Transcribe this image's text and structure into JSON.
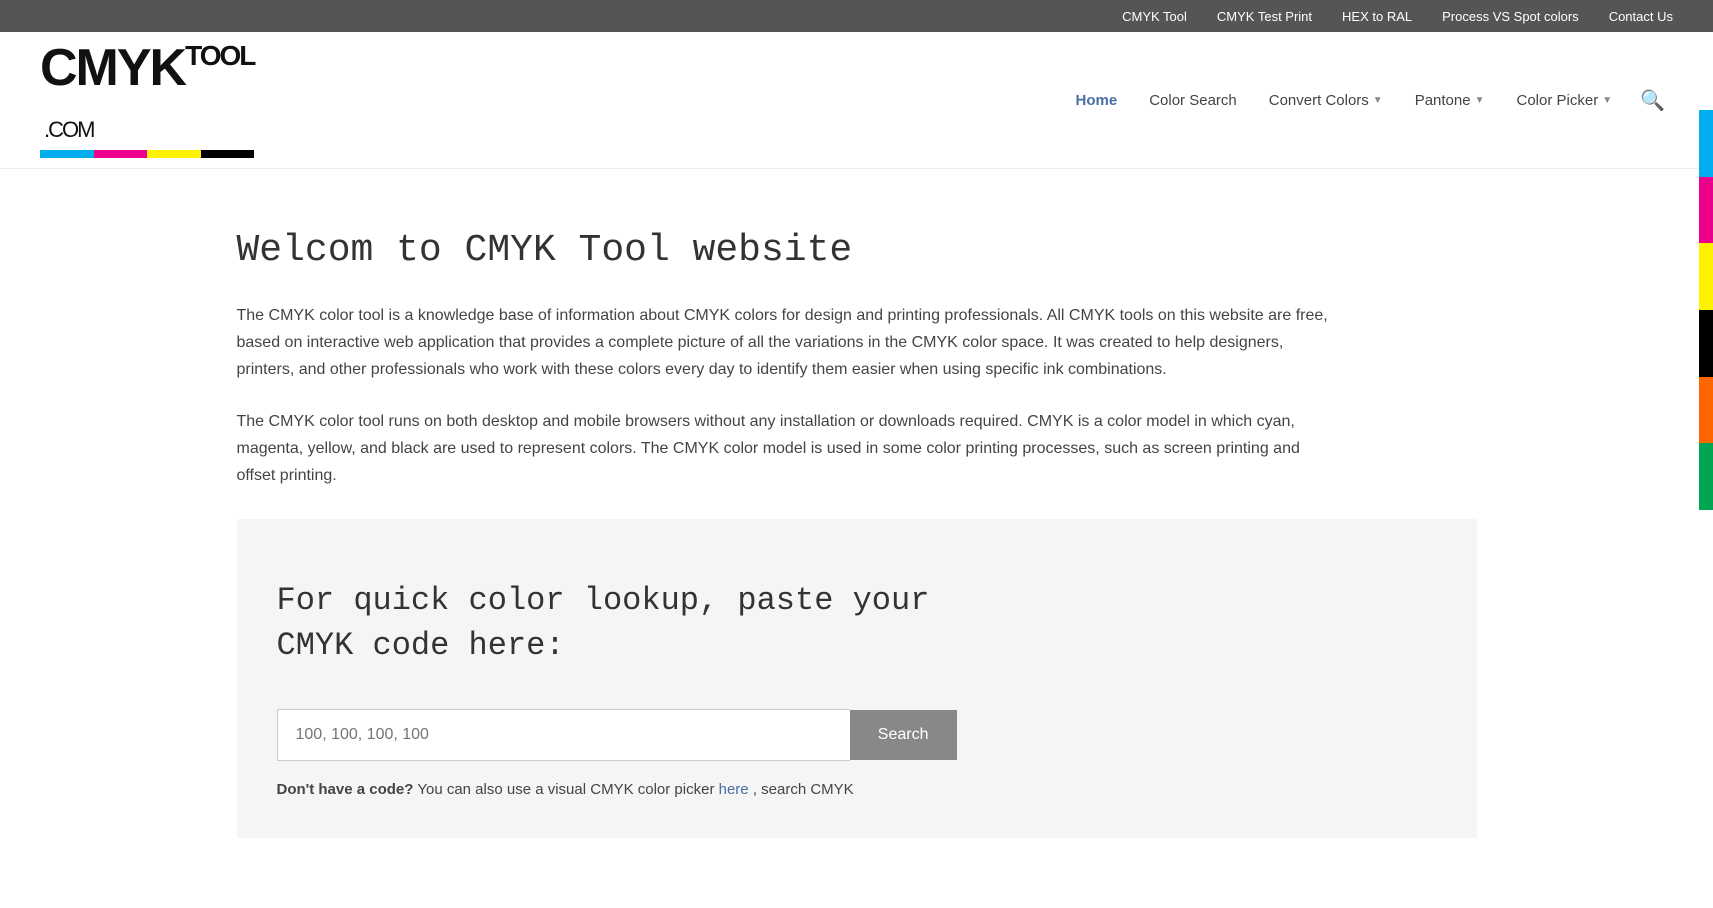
{
  "topbar": {
    "links": [
      {
        "label": "CMYK Tool",
        "id": "cmyk-tool"
      },
      {
        "label": "CMYK Test Print",
        "id": "cmyk-test-print"
      },
      {
        "label": "HEX to RAL",
        "id": "hex-to-ral"
      },
      {
        "label": "Process VS Spot colors",
        "id": "process-vs-spot"
      },
      {
        "label": "Contact Us",
        "id": "contact-us"
      }
    ]
  },
  "logo": {
    "cmyk": "CMYK",
    "tool": "TOOL",
    "dotcom": ".COM"
  },
  "nav": {
    "items": [
      {
        "label": "Home",
        "active": true,
        "hasArrow": false
      },
      {
        "label": "Color Search",
        "active": false,
        "hasArrow": false
      },
      {
        "label": "Convert Colors",
        "active": false,
        "hasArrow": true
      },
      {
        "label": "Pantone",
        "active": false,
        "hasArrow": true
      },
      {
        "label": "Color Picker",
        "active": false,
        "hasArrow": true
      }
    ]
  },
  "main": {
    "page_title": "Welcom to CMYK Tool website",
    "paragraph1": "The CMYK color tool is a knowledge base of information about CMYK colors for design and printing professionals. All CMYK tools on this website are free, based on interactive web application that provides a complete picture of all the variations in the CMYK color space. It was created to help designers, printers, and other professionals who work with these colors every day to identify them easier when using specific ink combinations.",
    "paragraph2": "The CMYK color tool runs on both desktop and mobile browsers without any installation or downloads required. CMYK is a color model in which cyan, magenta, yellow, and black are used to represent colors. The CMYK color model is used in some color printing processes, such as screen printing and offset printing.",
    "lookup_title": "For quick color lookup, paste your CMYK code here:",
    "input_placeholder": "100, 100, 100, 100",
    "search_button": "Search",
    "dont_have_prefix": "Don't have a code?",
    "dont_have_middle": " You can also use a visual CMYK color picker ",
    "here_label": "here",
    "dont_have_suffix": ", search CMYK"
  },
  "sidebar_colors": [
    "#00AEEF",
    "#EC008C",
    "#FFF200",
    "#000000",
    "#FF6600",
    "#00A651"
  ]
}
